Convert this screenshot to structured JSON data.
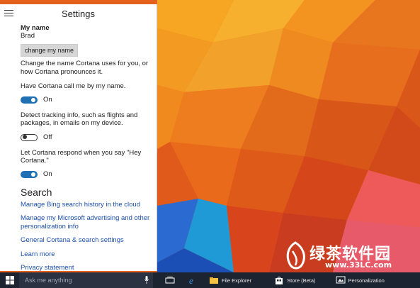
{
  "colors": {
    "toggle_on": "#1f6fb3",
    "link": "#1b4fa8",
    "taskbar": "#1d2431",
    "panel_bg": "#ffffff"
  },
  "panel": {
    "title": "Settings",
    "menu_icon": "hamburger-icon",
    "my_name_heading": "My name",
    "name_value": "Brad",
    "change_name_button": "change my name",
    "change_name_desc": "Change the name Cortana uses for you, or how Cortana pronounces it.",
    "call_me_desc": "Have Cortana call me by my name.",
    "call_me_state": "On",
    "tracking_desc": "Detect tracking info, such as flights and packages, in emails on my device.",
    "tracking_state": "Off",
    "hey_cortana_desc": "Let Cortana respond when you say \"Hey Cortana.\"",
    "hey_cortana_state": "On"
  },
  "search_section": {
    "title": "Search",
    "links": [
      "Manage Bing search history in the cloud",
      "Manage my Microsoft advertising and other personalization info",
      "General Cortana & search settings",
      "Learn more",
      "Privacy statement"
    ]
  },
  "taskbar": {
    "start_icon": "windows-logo-icon",
    "search_placeholder": "Ask me anything",
    "mic_icon": "microphone-icon",
    "items": [
      {
        "icon": "task-view-icon",
        "label": ""
      },
      {
        "icon": "edge-browser-icon",
        "label": ""
      },
      {
        "icon": "folder-icon",
        "label": "File Explorer"
      },
      {
        "icon": "store-icon",
        "label": "Store (Beta)"
      },
      {
        "icon": "personalization-icon",
        "label": "Personalization"
      }
    ]
  },
  "watermark": {
    "text": "绿茶软件园",
    "url": "www.33LC.com"
  }
}
